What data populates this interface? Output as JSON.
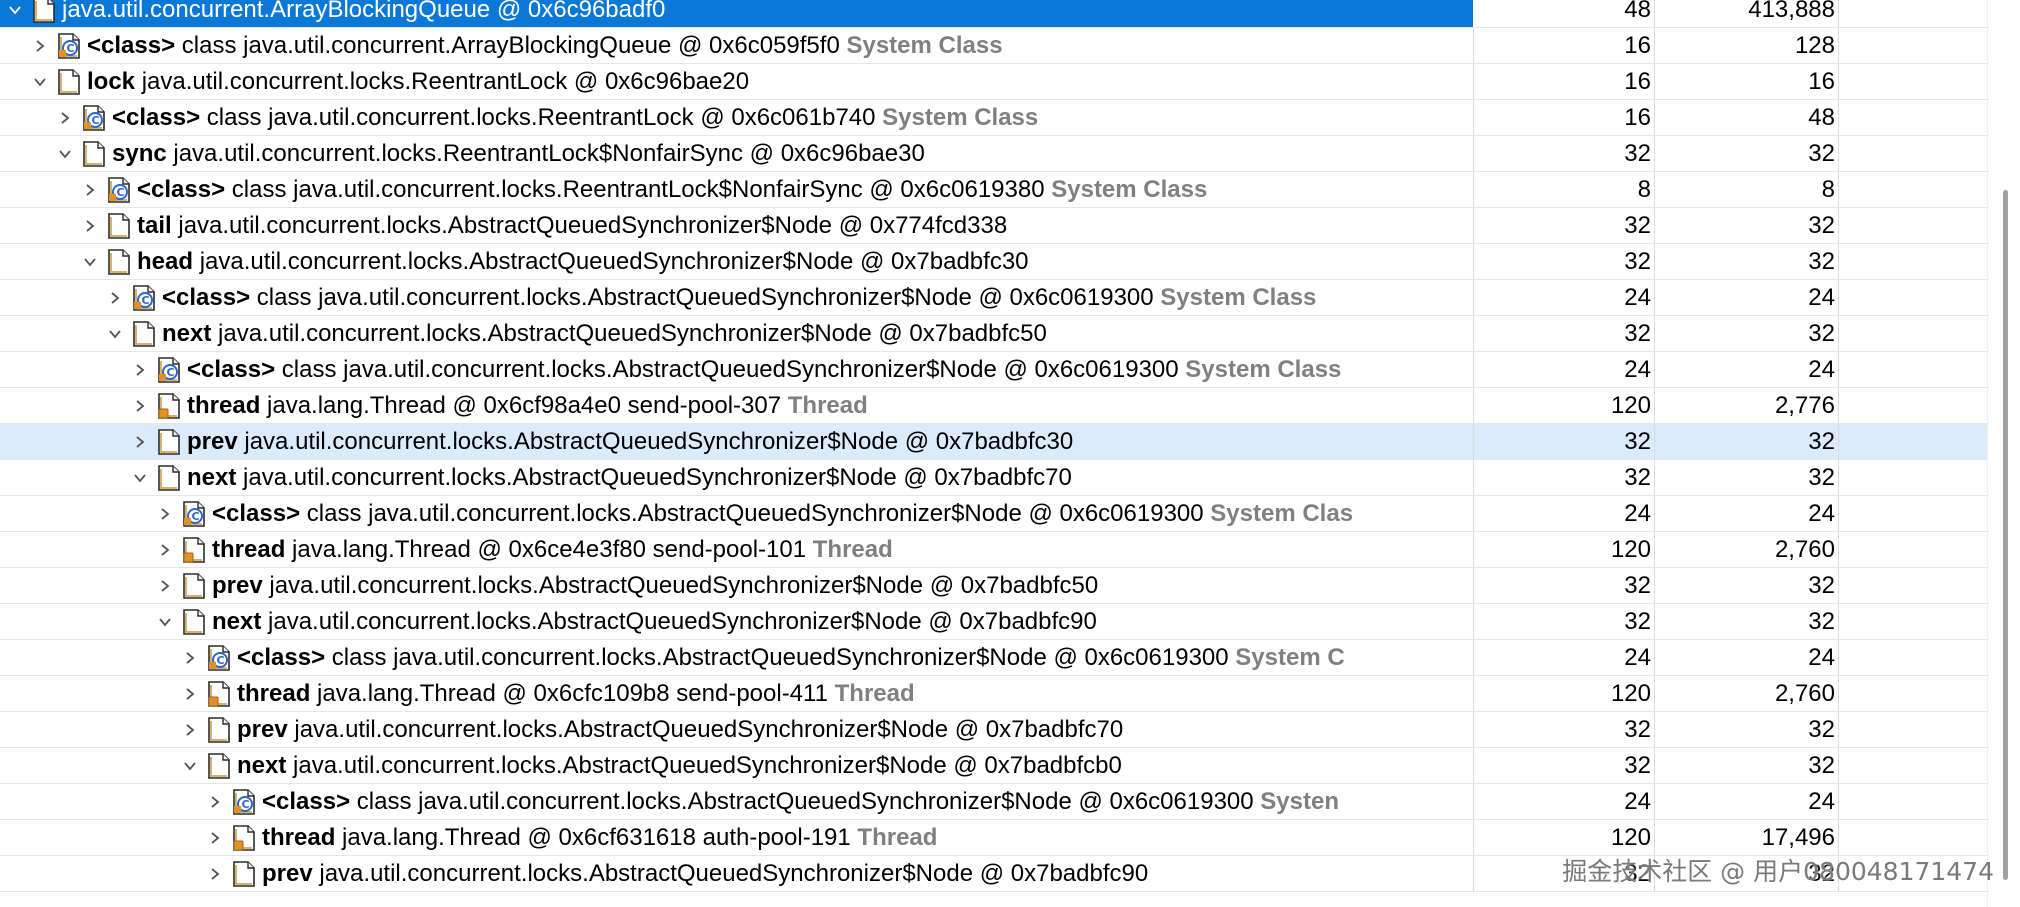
{
  "tree": {
    "rows": [
      {
        "depth": 0,
        "expanded": true,
        "icon": "object-icon",
        "field": "",
        "desc": "java.util.concurrent.ArrayBlockingQueue @ 0x6c96badf0",
        "suffix": "",
        "v1": "48",
        "v2": "413,888",
        "selected": true
      },
      {
        "depth": 1,
        "expanded": false,
        "icon": "class-icon",
        "field": "<class>",
        "desc": "class java.util.concurrent.ArrayBlockingQueue @ 0x6c059f5f0",
        "suffix": "System Class",
        "v1": "16",
        "v2": "128"
      },
      {
        "depth": 1,
        "expanded": true,
        "icon": "object-icon",
        "field": "lock",
        "desc": "java.util.concurrent.locks.ReentrantLock @ 0x6c96bae20",
        "suffix": "",
        "v1": "16",
        "v2": "16"
      },
      {
        "depth": 2,
        "expanded": false,
        "icon": "class-icon",
        "field": "<class>",
        "desc": "class java.util.concurrent.locks.ReentrantLock @ 0x6c061b740",
        "suffix": "System Class",
        "v1": "16",
        "v2": "48"
      },
      {
        "depth": 2,
        "expanded": true,
        "icon": "object-icon",
        "field": "sync",
        "desc": "java.util.concurrent.locks.ReentrantLock$NonfairSync @ 0x6c96bae30",
        "suffix": "",
        "v1": "32",
        "v2": "32"
      },
      {
        "depth": 3,
        "expanded": false,
        "icon": "class-icon",
        "field": "<class>",
        "desc": "class java.util.concurrent.locks.ReentrantLock$NonfairSync @ 0x6c0619380",
        "suffix": "System Class",
        "v1": "8",
        "v2": "8"
      },
      {
        "depth": 3,
        "expanded": false,
        "icon": "object-icon",
        "field": "tail",
        "desc": "java.util.concurrent.locks.AbstractQueuedSynchronizer$Node @ 0x774fcd338",
        "suffix": "",
        "v1": "32",
        "v2": "32"
      },
      {
        "depth": 3,
        "expanded": true,
        "icon": "object-icon",
        "field": "head",
        "desc": "java.util.concurrent.locks.AbstractQueuedSynchronizer$Node @ 0x7badbfc30",
        "suffix": "",
        "v1": "32",
        "v2": "32"
      },
      {
        "depth": 4,
        "expanded": false,
        "icon": "class-icon",
        "field": "<class>",
        "desc": "class java.util.concurrent.locks.AbstractQueuedSynchronizer$Node @ 0x6c0619300",
        "suffix": "System Class",
        "v1": "24",
        "v2": "24"
      },
      {
        "depth": 4,
        "expanded": true,
        "icon": "object-icon",
        "field": "next",
        "desc": "java.util.concurrent.locks.AbstractQueuedSynchronizer$Node @ 0x7badbfc50",
        "suffix": "",
        "v1": "32",
        "v2": "32"
      },
      {
        "depth": 5,
        "expanded": false,
        "icon": "class-icon",
        "field": "<class>",
        "desc": "class java.util.concurrent.locks.AbstractQueuedSynchronizer$Node @ 0x6c0619300",
        "suffix": "System Class",
        "v1": "24",
        "v2": "24"
      },
      {
        "depth": 5,
        "expanded": false,
        "icon": "thread-icon",
        "field": "thread",
        "desc": "java.lang.Thread @ 0x6cf98a4e0  send-pool-307",
        "suffix": "Thread",
        "v1": "120",
        "v2": "2,776"
      },
      {
        "depth": 5,
        "expanded": false,
        "icon": "object-icon",
        "field": "prev",
        "desc": "java.util.concurrent.locks.AbstractQueuedSynchronizer$Node @ 0x7badbfc30",
        "suffix": "",
        "v1": "32",
        "v2": "32",
        "hover": true
      },
      {
        "depth": 5,
        "expanded": true,
        "icon": "object-icon",
        "field": "next",
        "desc": "java.util.concurrent.locks.AbstractQueuedSynchronizer$Node @ 0x7badbfc70",
        "suffix": "",
        "v1": "32",
        "v2": "32"
      },
      {
        "depth": 6,
        "expanded": false,
        "icon": "class-icon",
        "field": "<class>",
        "desc": "class java.util.concurrent.locks.AbstractQueuedSynchronizer$Node @ 0x6c0619300",
        "suffix": "System Clas",
        "v1": "24",
        "v2": "24"
      },
      {
        "depth": 6,
        "expanded": false,
        "icon": "thread-icon",
        "field": "thread",
        "desc": "java.lang.Thread @ 0x6ce4e3f80  send-pool-101",
        "suffix": "Thread",
        "v1": "120",
        "v2": "2,760"
      },
      {
        "depth": 6,
        "expanded": false,
        "icon": "object-icon",
        "field": "prev",
        "desc": "java.util.concurrent.locks.AbstractQueuedSynchronizer$Node @ 0x7badbfc50",
        "suffix": "",
        "v1": "32",
        "v2": "32"
      },
      {
        "depth": 6,
        "expanded": true,
        "icon": "object-icon",
        "field": "next",
        "desc": "java.util.concurrent.locks.AbstractQueuedSynchronizer$Node @ 0x7badbfc90",
        "suffix": "",
        "v1": "32",
        "v2": "32"
      },
      {
        "depth": 7,
        "expanded": false,
        "icon": "class-icon",
        "field": "<class>",
        "desc": "class java.util.concurrent.locks.AbstractQueuedSynchronizer$Node @ 0x6c0619300",
        "suffix": "System C",
        "v1": "24",
        "v2": "24"
      },
      {
        "depth": 7,
        "expanded": false,
        "icon": "thread-icon",
        "field": "thread",
        "desc": "java.lang.Thread @ 0x6cfc109b8  send-pool-411",
        "suffix": "Thread",
        "v1": "120",
        "v2": "2,760"
      },
      {
        "depth": 7,
        "expanded": false,
        "icon": "object-icon",
        "field": "prev",
        "desc": "java.util.concurrent.locks.AbstractQueuedSynchronizer$Node @ 0x7badbfc70",
        "suffix": "",
        "v1": "32",
        "v2": "32"
      },
      {
        "depth": 7,
        "expanded": true,
        "icon": "object-icon",
        "field": "next",
        "desc": "java.util.concurrent.locks.AbstractQueuedSynchronizer$Node @ 0x7badbfcb0",
        "suffix": "",
        "v1": "32",
        "v2": "32"
      },
      {
        "depth": 8,
        "expanded": false,
        "icon": "class-icon",
        "field": "<class>",
        "desc": "class java.util.concurrent.locks.AbstractQueuedSynchronizer$Node @ 0x6c0619300",
        "suffix": "Systen",
        "v1": "24",
        "v2": "24"
      },
      {
        "depth": 8,
        "expanded": false,
        "icon": "thread-icon",
        "field": "thread",
        "desc": "java.lang.Thread @ 0x6cf631618  auth-pool-191",
        "suffix": "Thread",
        "v1": "120",
        "v2": "17,496"
      },
      {
        "depth": 8,
        "expanded": false,
        "icon": "object-icon",
        "field": "prev",
        "desc": "java.util.concurrent.locks.AbstractQueuedSynchronizer$Node @ 0x7badbfc90",
        "suffix": "",
        "v1": "32",
        "v2": "32"
      }
    ]
  },
  "watermark": "掘金技术社区 @ 用户080048171474",
  "colors": {
    "selection": "#0a78d7",
    "hover": "#dcebfa",
    "system_class": "#808080"
  }
}
